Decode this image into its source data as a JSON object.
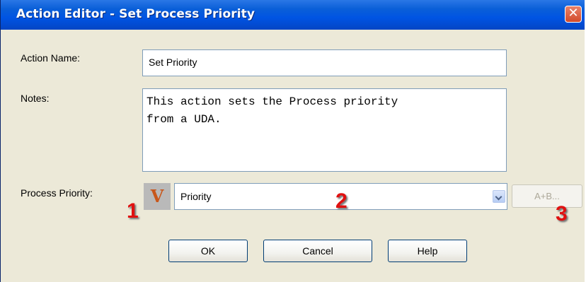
{
  "window": {
    "title": "Action Editor - Set Process Priority",
    "close_glyph": "✕"
  },
  "form": {
    "action_name_label": "Action Name:",
    "action_name_value": "Set Priority",
    "notes_label": "Notes:",
    "notes_value": "This action sets the Process priority\nfrom a UDA.",
    "process_priority_label": "Process Priority:",
    "variable_icon_glyph": "V",
    "process_priority_value": "Priority",
    "expression_button_label": "A+B..."
  },
  "buttons": {
    "ok": "OK",
    "cancel": "Cancel",
    "help": "Help"
  },
  "annotations": [
    "1",
    "2",
    "3"
  ],
  "colors": {
    "title_bar": "#0054E3",
    "dialog_bg": "#ECE9D8",
    "annotation": "#E01010",
    "variable_icon": "#C8571B"
  },
  "icons": {
    "variable": "variable-v-icon",
    "dropdown": "chevron-down-icon",
    "close": "close-icon"
  }
}
